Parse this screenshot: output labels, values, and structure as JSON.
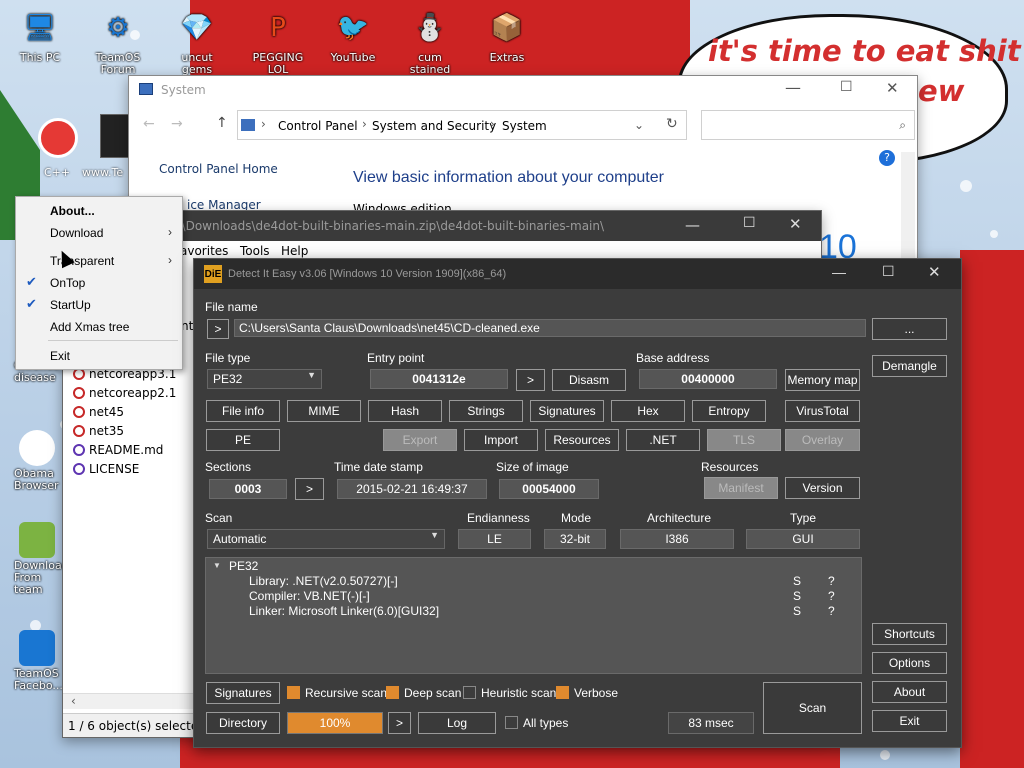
{
  "desktop": {
    "top_icons": [
      {
        "label": "This PC",
        "glyph": "🖥",
        "color": "#1e88e5"
      },
      {
        "label": "TeamOS Forum",
        "glyph": "⚙",
        "color": "#1976d2"
      },
      {
        "label": "uncut gems",
        "glyph": "💎",
        "color": "#29b6f6"
      },
      {
        "label": "PEGGING LOL",
        "glyph": "P",
        "color": "#e64a19"
      },
      {
        "label": "YouTube",
        "glyph": "🐦",
        "color": "#d32f2f"
      },
      {
        "label": "cum stained",
        "glyph": "⛄",
        "color": "#ffffff"
      },
      {
        "label": "Extras",
        "glyph": "📦",
        "color": "#c62828"
      }
    ],
    "left_icons": [
      {
        "label": "Chrones disease"
      },
      {
        "label": "Obama Browser"
      },
      {
        "label": "Download From team"
      },
      {
        "label": "TeamOS Facebo..."
      }
    ],
    "speech_text": "it's time to eat shit",
    "speech_text2": "ew",
    "partial_labels": {
      "cpp": "C++",
      "www": "www.Te"
    }
  },
  "system_window": {
    "title": "System",
    "breadcrumb": [
      "Control Panel",
      "System and Security",
      "System"
    ],
    "cp_home": "Control Panel Home",
    "device_manager": "ice Manager",
    "heading": "View basic information about your computer",
    "windows_edition": "Windows edition",
    "win_logo_text": "10"
  },
  "explorer_window": {
    "title": "laus\\Downloads\\de4dot-built-binaries-main.zip\\de4dot-built-binaries-main\\",
    "menu": [
      "avorites",
      "Tools",
      "Help"
    ],
    "files": [
      "netcoreapp3.1",
      "netcoreapp2.1",
      "net45",
      "net35",
      "README.md",
      "LICENSE"
    ],
    "status": "1 / 6 object(s) selected",
    "partial_text": "nt"
  },
  "context_menu": {
    "items": [
      {
        "label": "About...",
        "bold": true,
        "check": false,
        "arrow": false
      },
      {
        "label": "Download",
        "bold": false,
        "check": false,
        "arrow": true
      },
      {
        "label": "Transparent",
        "bold": false,
        "check": false,
        "arrow": true
      },
      {
        "label": "OnTop",
        "bold": false,
        "check": true,
        "arrow": false
      },
      {
        "label": "StartUp",
        "bold": false,
        "check": true,
        "arrow": false
      },
      {
        "label": "Add Xmas tree",
        "bold": false,
        "check": false,
        "arrow": false
      },
      {
        "label": "Exit",
        "bold": false,
        "check": false,
        "arrow": false
      }
    ]
  },
  "die": {
    "title": "Detect It Easy v3.06 [Windows 10 Version 1909](x86_64)",
    "file_name_label": "File name",
    "file_path": "C:\\Users\\Santa Claus\\Downloads\\net45\\CD-cleaned.exe",
    "go_btn": ">",
    "browse_btn": "...",
    "file_type_label": "File type",
    "file_type": "PE32",
    "entry_point_label": "Entry point",
    "entry_point": "0041312e",
    "disasm_btn": "Disasm",
    "base_address_label": "Base address",
    "base_address": "00400000",
    "memory_map_btn": "Memory map",
    "demangle_btn": "Demangle",
    "row1_btns": [
      "File info",
      "MIME",
      "Hash",
      "Strings",
      "Signatures",
      "Hex",
      "Entropy",
      "VirusTotal"
    ],
    "pe_btn": "PE",
    "row2_btns": [
      {
        "label": "Export",
        "enabled": false
      },
      {
        "label": "Import",
        "enabled": true
      },
      {
        "label": "Resources",
        "enabled": true
      },
      {
        "label": ".NET",
        "enabled": true
      },
      {
        "label": "TLS",
        "enabled": false
      },
      {
        "label": "Overlay",
        "enabled": false
      }
    ],
    "sections_label": "Sections",
    "sections": "0003",
    "time_label": "Time date stamp",
    "time": "2015-02-21 16:49:37",
    "size_label": "Size of image",
    "size": "00054000",
    "resources_label": "Resources",
    "manifest_btn": "Manifest",
    "version_btn": "Version",
    "scan_label": "Scan",
    "scan_mode": "Automatic",
    "endianness_label": "Endianness",
    "endianness": "LE",
    "mode_label": "Mode",
    "mode": "32-bit",
    "arch_label": "Architecture",
    "arch": "I386",
    "type_label": "Type",
    "type": "GUI",
    "tree_root": "PE32",
    "results": [
      {
        "text": "Library: .NET(v2.0.50727)[-]",
        "s": "S",
        "q": "?"
      },
      {
        "text": "Compiler: VB.NET(-)[-]",
        "s": "S",
        "q": "?"
      },
      {
        "text": "Linker: Microsoft Linker(6.0)[GUI32]",
        "s": "S",
        "q": "?"
      }
    ],
    "shortcuts_btn": "Shortcuts",
    "options_btn": "Options",
    "about_btn": "About",
    "exit_btn": "Exit",
    "signatures_btn": "Signatures",
    "recursive": "Recursive scan",
    "deep": "Deep scan",
    "heuristic": "Heuristic scan",
    "verbose": "Verbose",
    "directory_btn": "Directory",
    "progress_text": "100%",
    "progress_value": 1.0,
    "log_btn": "Log",
    "all_types": "All types",
    "time_ms": "83 msec",
    "scan_btn": "Scan"
  },
  "colors": {
    "accent": "#e08a2e",
    "die_bg": "#3c3c3c",
    "santa_red": "#cc2323"
  }
}
